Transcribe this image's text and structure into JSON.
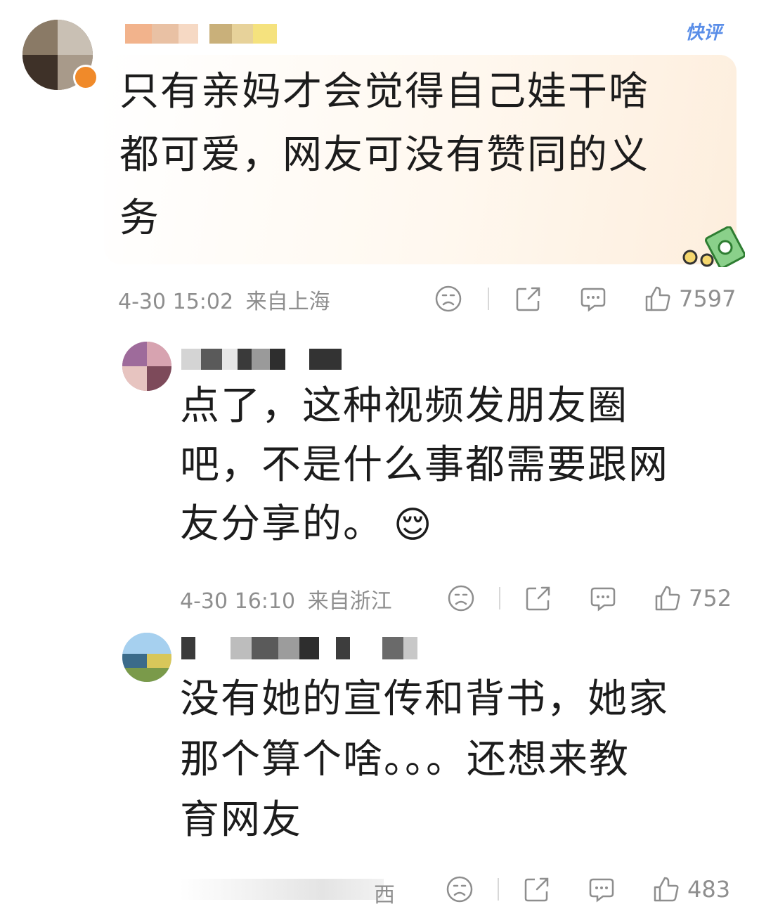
{
  "quick_badge": "快评",
  "comments": [
    {
      "text_lines": [
        "只有亲妈才会觉得自己娃干啥",
        "都可爱，网友可没有赞同的义",
        "务"
      ],
      "time": "4-30 15:02",
      "location": "来自上海",
      "likes": "7597"
    },
    {
      "text_lines": [
        "点了，这种视频发朋友圈",
        "吧，不是什么事都需要跟网",
        "友分享的。"
      ],
      "emoji": "😌",
      "time": "4-30 16:10",
      "location": "来自浙江",
      "likes": "752"
    },
    {
      "text_lines": [
        "没有她的宣传和背书，她家",
        "那个算个啥。。。还想来教",
        "育网友"
      ],
      "meta_partial": "西",
      "likes": "483"
    }
  ],
  "icons": {
    "dislike": "sad-face-icon",
    "share": "share-icon",
    "comment": "comment-icon",
    "like": "thumbs-up-icon",
    "decoration": "money-sticker-icon"
  }
}
